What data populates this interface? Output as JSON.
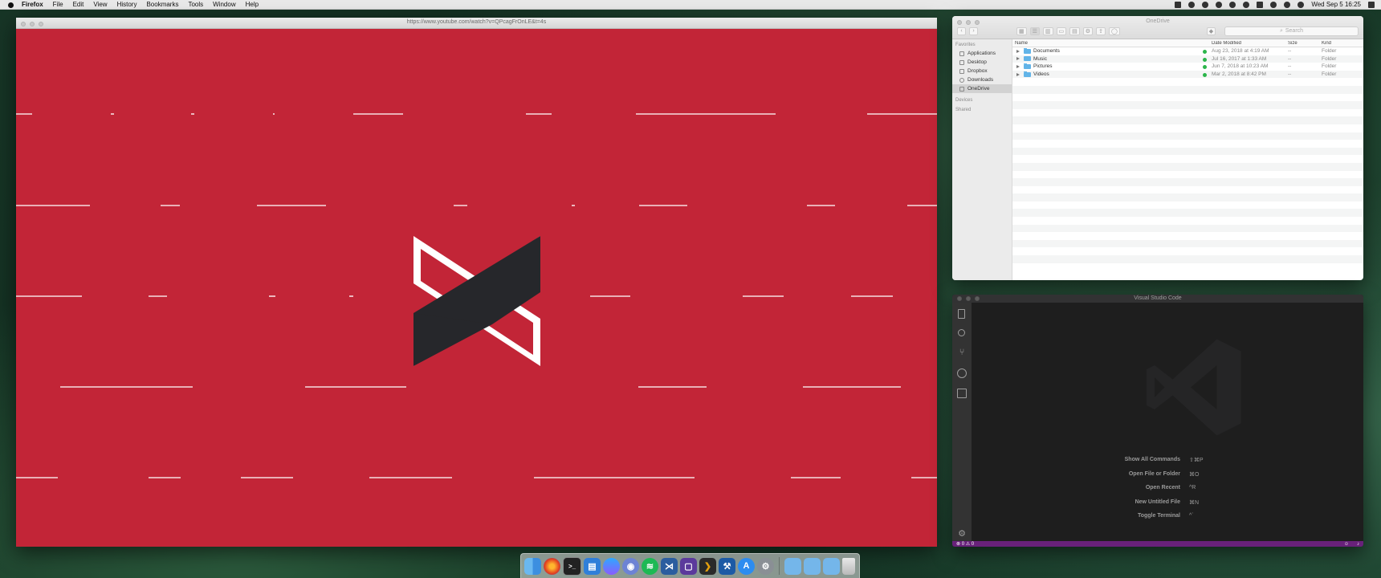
{
  "menubar": {
    "app_name": "Firefox",
    "items": [
      "File",
      "Edit",
      "View",
      "History",
      "Bookmarks",
      "Tools",
      "Window",
      "Help"
    ],
    "clock": "Wed Sep 5  16:25"
  },
  "firefox": {
    "url": "https://www.youtube.com/watch?v=QPcagFrOnLE&t=4s",
    "video_bg": "#c22537"
  },
  "finder": {
    "title": "OneDrive",
    "search_placeholder": "Search",
    "sidebar": {
      "favorites_label": "Favorites",
      "favorites": [
        "Applications",
        "Desktop",
        "Dropbox",
        "Downloads",
        "OneDrive"
      ],
      "selected": "OneDrive",
      "devices_label": "Devices",
      "shared_label": "Shared"
    },
    "columns": {
      "name": "Name",
      "date": "Date Modified",
      "size": "Size",
      "kind": "Kind"
    },
    "rows": [
      {
        "name": "Documents",
        "date": "Aug 23, 2018 at 4:19 AM",
        "size": "--",
        "kind": "Folder"
      },
      {
        "name": "Music",
        "date": "Jul 16, 2017 at 1:33 AM",
        "size": "--",
        "kind": "Folder"
      },
      {
        "name": "Pictures",
        "date": "Jun 7, 2018 at 10:23 AM",
        "size": "--",
        "kind": "Folder"
      },
      {
        "name": "Videos",
        "date": "Mar 2, 2018 at 8:42 PM",
        "size": "--",
        "kind": "Folder"
      }
    ]
  },
  "vscode": {
    "title": "Visual Studio Code",
    "tips": [
      {
        "label": "Show All Commands",
        "key": "⇧⌘P"
      },
      {
        "label": "Open File or Folder",
        "key": "⌘O"
      },
      {
        "label": "Open Recent",
        "key": "^R"
      },
      {
        "label": "New Untitled File",
        "key": "⌘N"
      },
      {
        "label": "Toggle Terminal",
        "key": "^`"
      }
    ],
    "status": {
      "errors": "0",
      "warnings": "0"
    },
    "accent": "#68217a"
  },
  "dock": {
    "apps": [
      "Finder",
      "Firefox",
      "Terminal",
      "Notes",
      "Messenger",
      "Discord",
      "Spotify",
      "Visual Studio Code",
      "Twitch",
      "Plex",
      "Xcode",
      "App Store",
      "System Preferences"
    ],
    "folders": [
      "Applications",
      "Documents",
      "Downloads"
    ],
    "trash": "Trash"
  }
}
